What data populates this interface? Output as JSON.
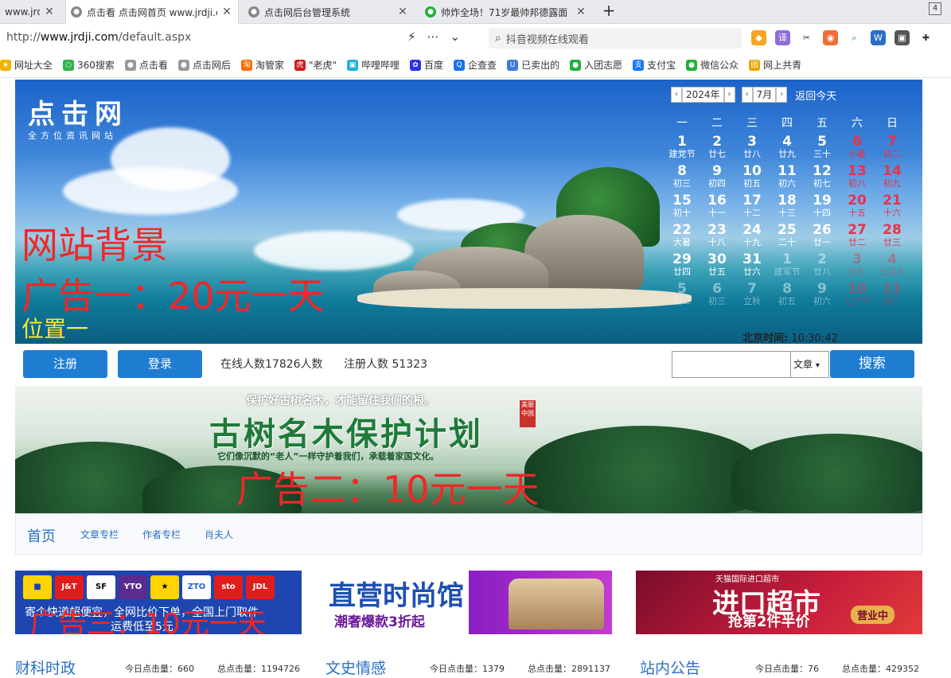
{
  "browser": {
    "tabs": [
      {
        "title": "www.jrdji.com",
        "active": false
      },
      {
        "title": "点击看 点击网首页 www.jrdji.com",
        "active": true
      },
      {
        "title": "点击网后台管理系统",
        "active": false
      },
      {
        "title": "帅炸全场！71岁最帅邦德露面",
        "active": false
      }
    ],
    "new_tab": "+",
    "tab_count": "4",
    "url_prefix": "http://",
    "url_host": "www.jrdji.com",
    "url_path": "/default.aspx",
    "search_placeholder": "抖音视频在线观看",
    "bookmarks": [
      "网址大全",
      "360搜索",
      "点击看",
      "点击网后",
      "淘管家",
      "\"老虎\"",
      "哔哩哔哩",
      "百度",
      "企查查",
      "已卖出的",
      "入团志愿",
      "支付宝",
      "微信公众",
      "网上共青"
    ]
  },
  "site": {
    "logo_main": "点击网",
    "logo_sub": "全方位资讯网站",
    "ad1_line1": "网站背景",
    "ad1_line2": "广告一：20元一天",
    "ad1_line3": "位置一",
    "calendar": {
      "year": "2024年",
      "month": "7月",
      "today_link": "返回今天",
      "weekdays": [
        "一",
        "二",
        "三",
        "四",
        "五",
        "六",
        "日"
      ],
      "rows": [
        [
          [
            "1",
            "建党节"
          ],
          [
            "2",
            "廿七"
          ],
          [
            "3",
            "廿八"
          ],
          [
            "4",
            "廿九"
          ],
          [
            "5",
            "三十"
          ],
          [
            "6",
            "小暑"
          ],
          [
            "7",
            "初二"
          ]
        ],
        [
          [
            "8",
            "初三"
          ],
          [
            "9",
            "初四"
          ],
          [
            "10",
            "初五"
          ],
          [
            "11",
            "初六"
          ],
          [
            "12",
            "初七"
          ],
          [
            "13",
            "初八"
          ],
          [
            "14",
            "初九"
          ]
        ],
        [
          [
            "15",
            "初十"
          ],
          [
            "16",
            "十一"
          ],
          [
            "17",
            "十二"
          ],
          [
            "18",
            "十三"
          ],
          [
            "19",
            "十四"
          ],
          [
            "20",
            "十五"
          ],
          [
            "21",
            "十六"
          ]
        ],
        [
          [
            "22",
            "大暑"
          ],
          [
            "23",
            "十八"
          ],
          [
            "24",
            "十九"
          ],
          [
            "25",
            "二十"
          ],
          [
            "26",
            "廿一"
          ],
          [
            "27",
            "廿二"
          ],
          [
            "28",
            "廿三"
          ]
        ],
        [
          [
            "29",
            "廿四"
          ],
          [
            "30",
            "廿五"
          ],
          [
            "31",
            "廿六"
          ],
          [
            "1",
            "建军节"
          ],
          [
            "2",
            "廿八"
          ],
          [
            "3",
            "廿九"
          ],
          [
            "4",
            "七月大"
          ]
        ],
        [
          [
            "5",
            "初二"
          ],
          [
            "6",
            "初三"
          ],
          [
            "7",
            "立秋"
          ],
          [
            "8",
            "初五"
          ],
          [
            "9",
            "初六"
          ],
          [
            "10",
            "七夕节"
          ],
          [
            "11",
            "初八"
          ]
        ]
      ],
      "time_label": "北京时间:",
      "time_value": "10:30:42"
    },
    "register_label": "注册",
    "login_label": "登录",
    "online_label": "在线人数17826人数",
    "registered_label": "注册人数 51323",
    "search_type": "文章",
    "search_button": "搜索",
    "ad2_slogan": "保护好古树名木，才能留住我们的根。",
    "ad2_title": "古树名木保护计划",
    "ad2_seal": "美丽中国",
    "ad2_sub": "它们像沉默的“老人”一样守护着我们，承载着家国文化。",
    "ad2_label": "广告二：10元一天",
    "nav": {
      "home": "首页",
      "items": [
        "文章专栏",
        "作者专栏",
        "肖夫人"
      ]
    },
    "ad3a": {
      "logos": [
        "J&T",
        "SF",
        "YTO",
        "★",
        "ZTO",
        "sto",
        "JDL"
      ],
      "text1": "寄个快递超便宜，全网比价下单，全国上门取件",
      "text2": "运费低至5元",
      "label": "广告三：10元一天"
    },
    "ad3b": {
      "title": "直营时尚馆",
      "badge": "潮奢爆款3折起"
    },
    "ad3c": {
      "top": "天猫国际进口超市",
      "title": "进口超市",
      "sub": "抢第2件半价",
      "badge": "营业中"
    },
    "sections": [
      {
        "title": "财科时政",
        "today": "今日点击量：660",
        "total": "总点击量：1194726"
      },
      {
        "title": "文史情感",
        "today": "今日点击量：1379",
        "total": "总点击量：2891137"
      },
      {
        "title": "站内公告",
        "today": "今日点击量：76",
        "total": "总点击量：429352"
      }
    ]
  }
}
